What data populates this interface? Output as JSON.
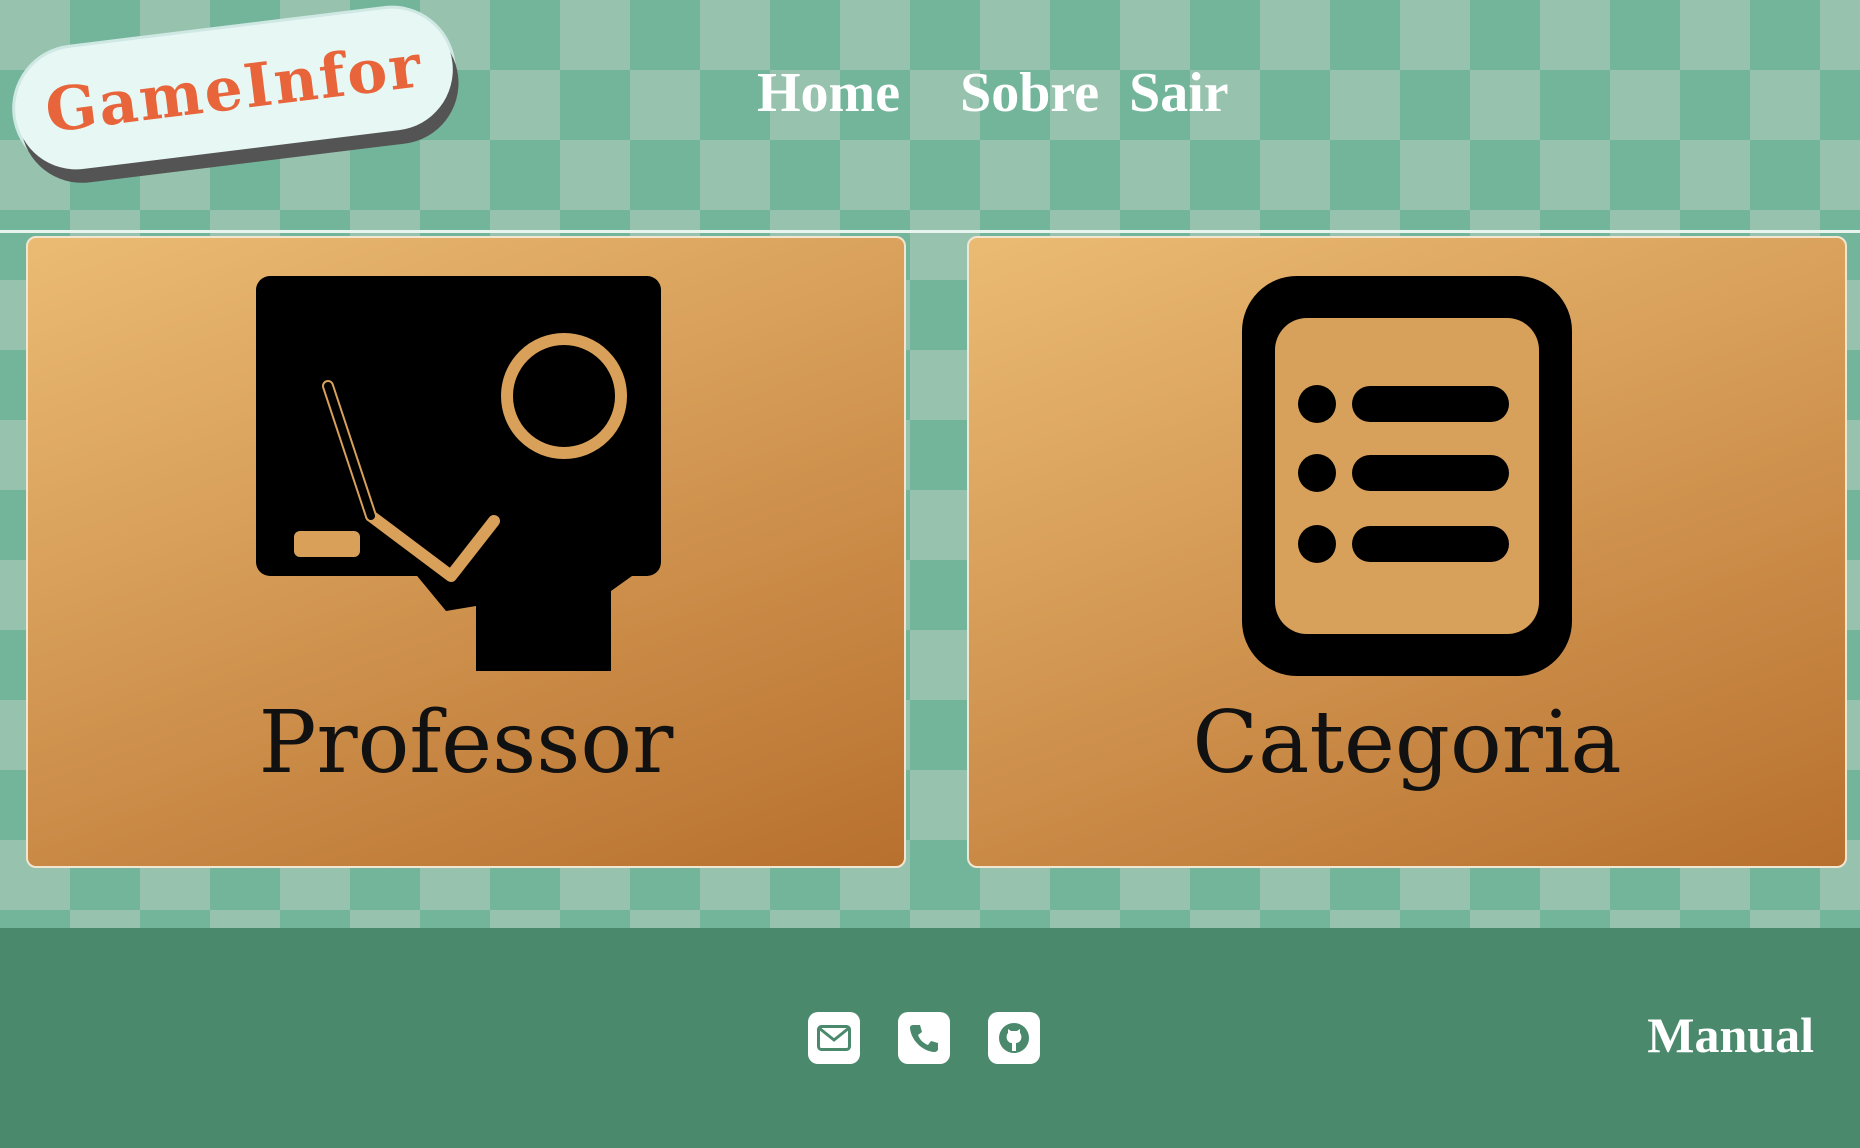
{
  "app": {
    "logo_text": "GameInfor"
  },
  "nav": {
    "home": "Home",
    "sobre": "Sobre",
    "sair": "Sair"
  },
  "cards": [
    {
      "label": "Professor",
      "icon": "teacher-board-icon"
    },
    {
      "label": "Categoria",
      "icon": "list-document-icon"
    }
  ],
  "footer": {
    "icons": [
      "email-icon",
      "phone-icon",
      "github-icon"
    ],
    "manual_label": "Manual"
  },
  "colors": {
    "logo_text": "#e8643a",
    "card_gradient_start": "#ebbb73",
    "card_gradient_end": "#b8702e",
    "footer": "#4a896c",
    "pattern_light": "#97c3ae",
    "pattern_dark": "#72b59a"
  }
}
